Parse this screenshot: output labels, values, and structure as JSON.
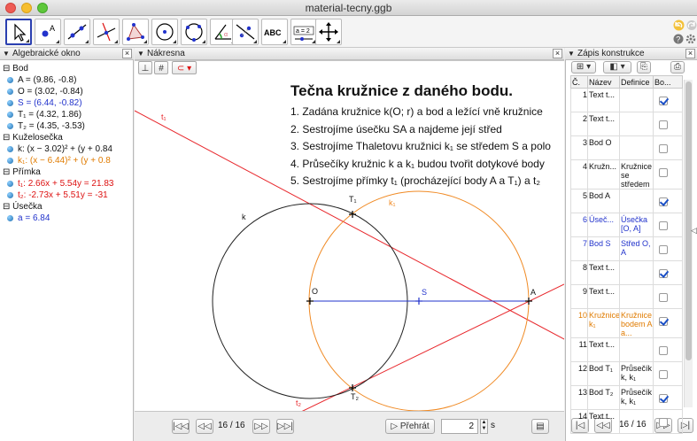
{
  "window": {
    "title": "material-tecny.ggb"
  },
  "algebra": {
    "title": "Algebraické okno",
    "groups": [
      {
        "name": "Bod",
        "items": [
          "A = (9.86, -0.8)",
          "O = (3.02, -0.84)",
          "S = (6.44, -0.82)",
          "T₁ = (4.32, 1.86)",
          "T₂ = (4.35, -3.53)"
        ]
      },
      {
        "name": "Kuželosečka",
        "items": [
          "k: (x − 3.02)² + (y + 0.84",
          "k₁: (x − 6.44)² + (y + 0.8"
        ]
      },
      {
        "name": "Přímka",
        "items": [
          "t₁: 2.66x + 5.54y = 21.83",
          "t₂: -2.73x + 5.51y = -31"
        ]
      },
      {
        "name": "Úsečka",
        "items": [
          "a = 6.84"
        ]
      }
    ]
  },
  "graphics": {
    "title": "Nákresna",
    "heading": "Tečna kružnice z daného bodu.",
    "steps": [
      "1. Zadána kružnice k(O; r) a bod a ležící vně kružnice",
      "2. Sestrojíme úsečku SA a najdeme její střed",
      "3. Sestrojíme Thaletovu kružnici k₁ se středem S a polo",
      "4. Průsečíky kružnic k a k₁ budou tvořit dotykové body",
      "5. Sestrojíme přímky t₁ (procházející body A a T₁) a t₂"
    ],
    "labels": {
      "O": "O",
      "S": "S",
      "A": "A",
      "T1": "T₁",
      "T2": "T₂",
      "k": "k",
      "k1": "k₁",
      "t1": "t₁",
      "t2": "t₂"
    }
  },
  "navigation": {
    "step_text": "16 / 16",
    "play_label": "Přehrát",
    "speed_value": "2",
    "speed_unit": "s"
  },
  "construction": {
    "title": "Zápis konstrukce",
    "headers": [
      "Č.",
      "Název",
      "Definice",
      "Bo..."
    ],
    "rows": [
      {
        "no": "1",
        "name": "Text t...",
        "def": "",
        "checked": true,
        "color": "black"
      },
      {
        "no": "2",
        "name": "Text t...",
        "def": "",
        "checked": false,
        "color": "black"
      },
      {
        "no": "3",
        "name": "Bod O",
        "def": "",
        "checked": false,
        "color": "black"
      },
      {
        "no": "4",
        "name": "Kružn...",
        "def": "Kružnice se středem",
        "checked": false,
        "color": "black"
      },
      {
        "no": "5",
        "name": "Bod A",
        "def": "",
        "checked": true,
        "color": "black"
      },
      {
        "no": "6",
        "name": "Úseč...",
        "def": "Úsečka [O, A]",
        "checked": false,
        "color": "blue"
      },
      {
        "no": "7",
        "name": "Bod S",
        "def": "Střed O, A",
        "checked": false,
        "color": "blue"
      },
      {
        "no": "8",
        "name": "Text t...",
        "def": "",
        "checked": true,
        "color": "black"
      },
      {
        "no": "9",
        "name": "Text t...",
        "def": "",
        "checked": false,
        "color": "black"
      },
      {
        "no": "10",
        "name": "Kružnice k₁",
        "def": "Kružnice bodem A a...",
        "checked": true,
        "color": "orange"
      },
      {
        "no": "11",
        "name": "Text t...",
        "def": "",
        "checked": false,
        "color": "black"
      },
      {
        "no": "12",
        "name": "Bod T₁",
        "def": "Průsečík k, k₁",
        "checked": false,
        "color": "black"
      },
      {
        "no": "13",
        "name": "Bod T₂",
        "def": "Průsečík k, k₁",
        "checked": true,
        "color": "black"
      },
      {
        "no": "14",
        "name": "Text t...",
        "def": "",
        "checked": false,
        "color": "black"
      }
    ],
    "nav_text": "16 / 16"
  },
  "colors": {
    "accent": "#2a3fb0",
    "line_red": "#e8262b",
    "circle_orange": "#f08a24",
    "segment_blue": "#2233cc"
  }
}
